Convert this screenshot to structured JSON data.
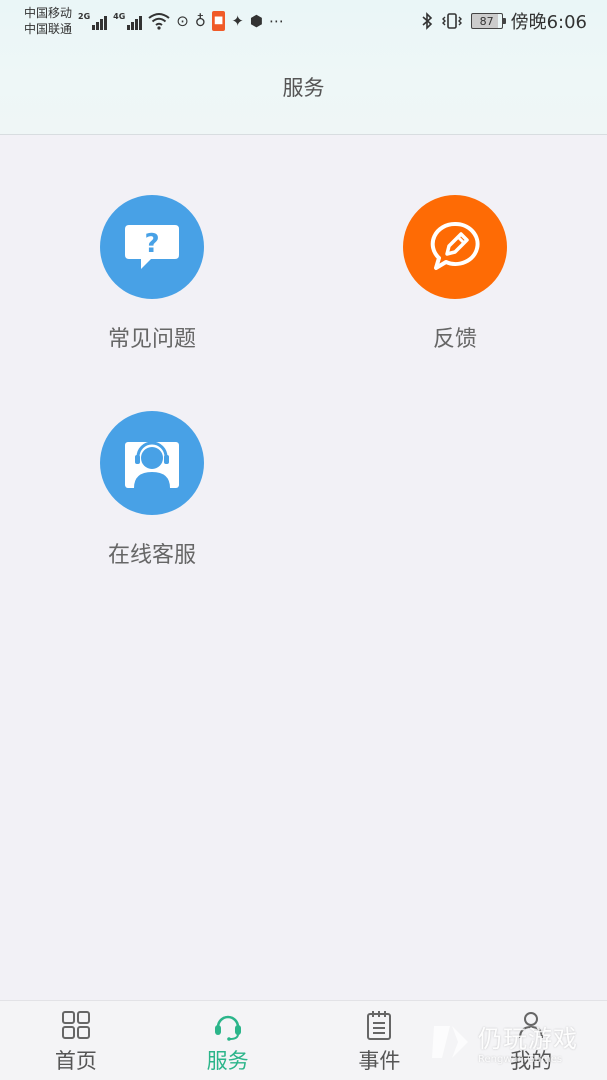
{
  "status_bar": {
    "carrier_1": "中国移动",
    "carrier_2": "中国联通",
    "net_1": "2G",
    "net_2": "4G",
    "battery": "87",
    "time": "傍晚6:06",
    "icons": [
      "signal-icon",
      "wifi-icon",
      "vibrate-icon",
      "bluetooth-icon",
      "battery-icon"
    ]
  },
  "header": {
    "title": "服务"
  },
  "services": {
    "faq": {
      "label": "常见问题",
      "icon": "question-bubble-icon",
      "color": "#48a1e6"
    },
    "feedback": {
      "label": "反馈",
      "icon": "pencil-bubble-icon",
      "color": "#fe6b05"
    },
    "customer_service": {
      "label": "在线客服",
      "icon": "headset-agent-icon",
      "color": "#48a1e6"
    }
  },
  "tabbar": {
    "active_color": "#2bb58a",
    "tabs": [
      {
        "label": "首页",
        "icon": "grid-icon"
      },
      {
        "label": "服务",
        "icon": "headset-icon",
        "active": true
      },
      {
        "label": "事件",
        "icon": "notepad-icon"
      },
      {
        "label": "我的",
        "icon": "person-icon"
      }
    ]
  },
  "watermark": {
    "cn": "仍玩游戏",
    "en": "Rengwan Games"
  }
}
